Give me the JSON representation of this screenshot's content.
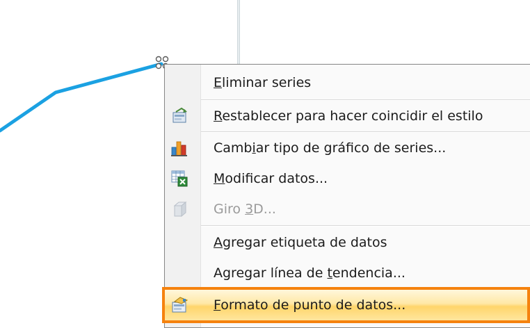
{
  "chart": {
    "series_color": "#1ba1e2"
  },
  "context_menu": {
    "items": [
      {
        "pre": "",
        "key": "E",
        "post": "liminar series",
        "icon": "",
        "enabled": true
      },
      {
        "pre": "",
        "key": "R",
        "post": "establecer para hacer coincidir el estilo",
        "icon": "reset-style-icon",
        "enabled": true
      },
      {
        "pre": "Camb",
        "key": "i",
        "post": "ar tipo de gráfico de series...",
        "icon": "bar-chart-icon",
        "enabled": true
      },
      {
        "pre": "",
        "key": "M",
        "post": "odificar datos...",
        "icon": "excel-data-icon",
        "enabled": true
      },
      {
        "pre": "Giro ",
        "key": "3",
        "post": "D...",
        "icon": "3d-rotation-icon",
        "enabled": false
      },
      {
        "pre": "",
        "key": "A",
        "post": "gregar etiqueta de datos",
        "icon": "",
        "enabled": true
      },
      {
        "pre": "Agregar línea de ",
        "key": "t",
        "post": "endencia...",
        "icon": "",
        "enabled": true
      },
      {
        "pre": "",
        "key": "F",
        "post": "ormato de punto de datos...",
        "icon": "format-data-point-icon",
        "enabled": true,
        "highlighted": true
      }
    ]
  },
  "colors": {
    "highlight_border": "#f5820e",
    "highlight_fill": "#ffe3a0",
    "disabled_text": "#9a9a9a"
  }
}
